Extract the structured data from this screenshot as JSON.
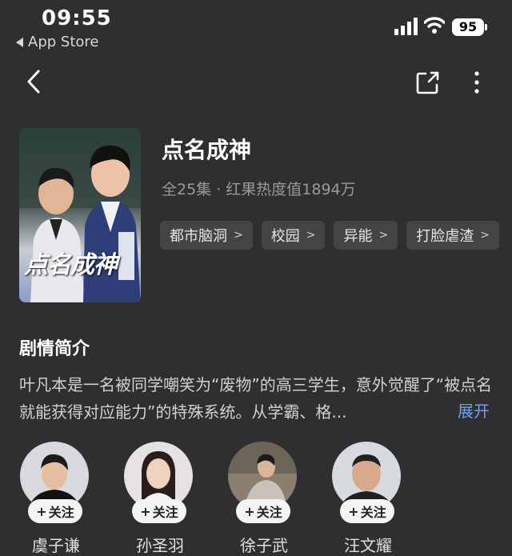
{
  "status_bar": {
    "time": "09:55",
    "back_app_label": "App Store",
    "battery": "95"
  },
  "drama": {
    "poster_title": "点名成神",
    "title": "点名成神",
    "meta": "全25集 · 红果热度值1894万",
    "tags": [
      "都市脑洞",
      "校园",
      "异能",
      "打脸虐渣"
    ]
  },
  "synopsis": {
    "heading": "剧情简介",
    "text": "叶凡本是一名被同学嘲笑为“废物”的高三学生，意外觉醒了“被点名就能获得对应能力”的特殊系统。从学霸、格...",
    "expand_label": "展开"
  },
  "cast": {
    "follow_label": "关注",
    "members": [
      {
        "name": "虞子谦"
      },
      {
        "name": "孙圣羽"
      },
      {
        "name": "徐子武"
      },
      {
        "name": "汪文耀"
      }
    ]
  }
}
